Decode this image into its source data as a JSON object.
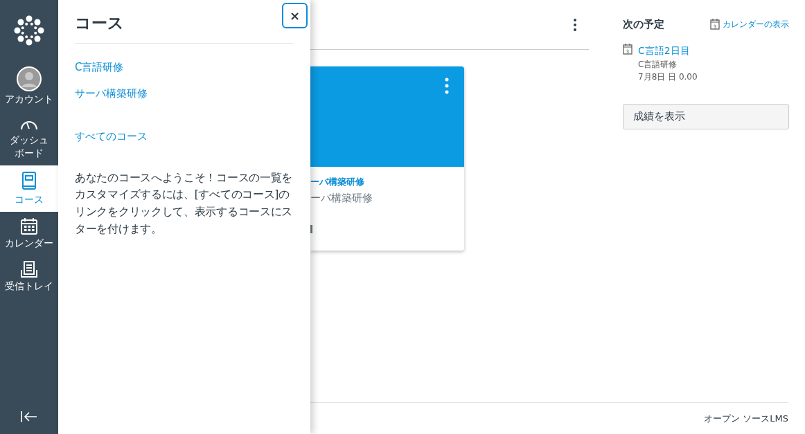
{
  "sidebar": {
    "items": [
      {
        "kind": "logo"
      },
      {
        "kind": "avatar",
        "label": "アカウント",
        "selected": false
      },
      {
        "kind": "dashboard",
        "label": "ダッシュボード",
        "selected": false
      },
      {
        "kind": "courses",
        "label": "コース",
        "selected": true
      },
      {
        "kind": "calendar",
        "label": "カレンダー",
        "selected": false
      },
      {
        "kind": "inbox",
        "label": "受信トレイ",
        "selected": false
      }
    ]
  },
  "tray": {
    "title": "コース",
    "close": "×",
    "courses": [
      "C言語研修",
      "サーバ構築研修"
    ],
    "all_courses": "すべてのコース",
    "description": "あなたのコースへようこそ！コースの一覧をカスタマイズするには、[すべてのコース]のリンクをクリックして、表示するコースにスターを付けます。"
  },
  "course_card": {
    "color": "#0b9be3",
    "title": "ーバ構築研修",
    "subtitle": "ーバ構築研修"
  },
  "upcoming": {
    "title": "次の予定",
    "calendar_link": "カレンダーの表示",
    "icon_day": "3",
    "events": [
      {
        "icon_day": "3",
        "title": "C言語2日目",
        "course": "C言語研修",
        "date": "7月8日 日 0.00"
      }
    ],
    "grades_button": "成績を表示"
  },
  "footer": {
    "text": "オープン ソースLMS"
  }
}
